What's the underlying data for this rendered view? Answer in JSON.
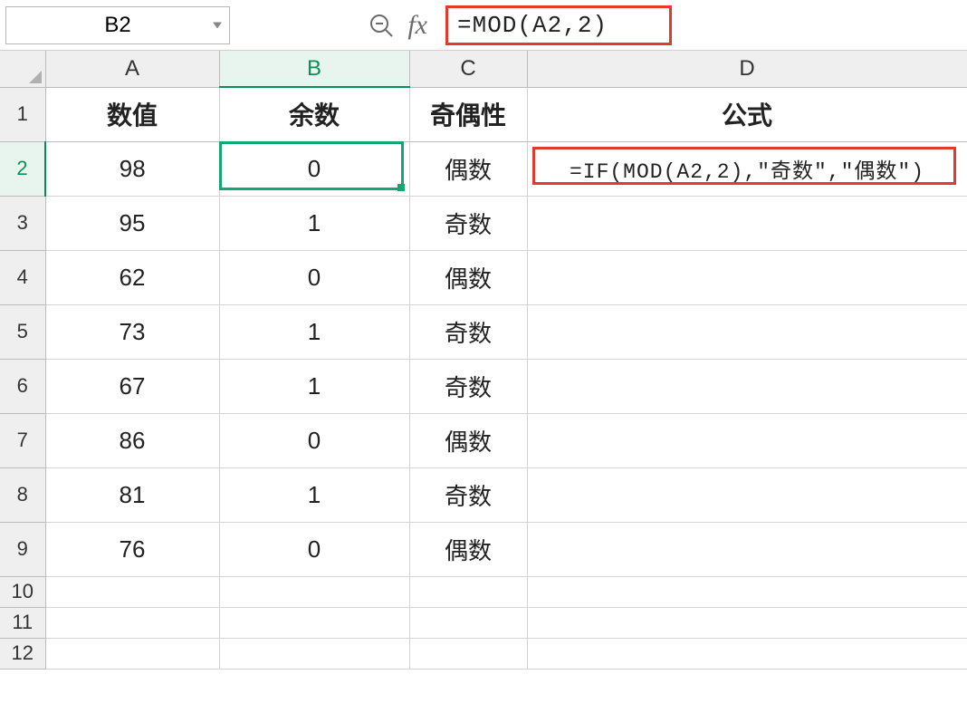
{
  "name_box": "B2",
  "formula_bar": "=MOD(A2,2)",
  "columns": [
    "A",
    "B",
    "C",
    "D"
  ],
  "row_numbers": [
    "1",
    "2",
    "3",
    "4",
    "5",
    "6",
    "7",
    "8",
    "9",
    "10",
    "11",
    "12"
  ],
  "headers": {
    "A": "数值",
    "B": "余数",
    "C": "奇偶性",
    "D": "公式"
  },
  "rows": [
    {
      "A": "98",
      "B": "0",
      "C": "偶数",
      "D": "=IF(MOD(A2,2),\"奇数\",\"偶数\")"
    },
    {
      "A": "95",
      "B": "1",
      "C": "奇数",
      "D": ""
    },
    {
      "A": "62",
      "B": "0",
      "C": "偶数",
      "D": ""
    },
    {
      "A": "73",
      "B": "1",
      "C": "奇数",
      "D": ""
    },
    {
      "A": "67",
      "B": "1",
      "C": "奇数",
      "D": ""
    },
    {
      "A": "86",
      "B": "0",
      "C": "偶数",
      "D": ""
    },
    {
      "A": "81",
      "B": "1",
      "C": "奇数",
      "D": ""
    },
    {
      "A": "76",
      "B": "0",
      "C": "偶数",
      "D": ""
    }
  ],
  "active_cell": "B2",
  "active_col": "B",
  "active_row": "2"
}
